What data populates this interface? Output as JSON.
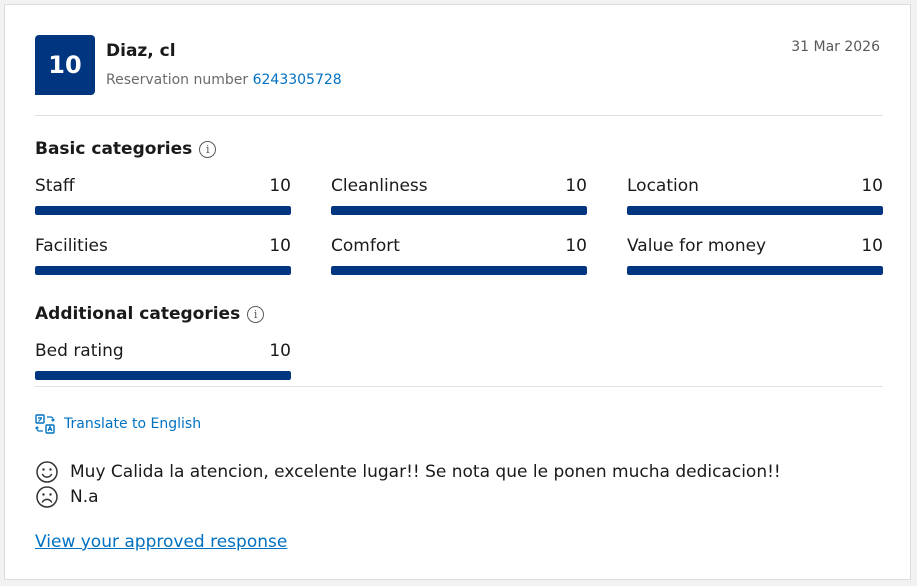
{
  "review": {
    "score": "10",
    "guest_name": "Diaz, cl",
    "reservation_label": "Reservation number",
    "reservation_number": "6243305728",
    "date": "31 Mar 2026"
  },
  "basic": {
    "title": "Basic categories",
    "items": [
      {
        "label": "Staff",
        "value": "10",
        "fill": 1.0
      },
      {
        "label": "Cleanliness",
        "value": "10",
        "fill": 1.0
      },
      {
        "label": "Location",
        "value": "10",
        "fill": 1.0
      },
      {
        "label": "Facilities",
        "value": "10",
        "fill": 1.0
      },
      {
        "label": "Comfort",
        "value": "10",
        "fill": 1.0
      },
      {
        "label": "Value for money",
        "value": "10",
        "fill": 1.0
      }
    ]
  },
  "additional": {
    "title": "Additional categories",
    "items": [
      {
        "label": "Bed rating",
        "value": "10",
        "fill": 1.0
      }
    ]
  },
  "translate_label": "Translate to English",
  "positive_text": "Muy Calida la atencion, excelente lugar!! Se nota que le ponen mucha dedicacion!!",
  "negative_text": "N.a",
  "approved_response_link": "View your approved response",
  "icons": {
    "info": "info-icon",
    "translate": "translate-icon",
    "positive": "smiley-face-icon",
    "negative": "frowning-face-icon"
  },
  "colors": {
    "brand": "#003580",
    "link": "#0071c2"
  }
}
